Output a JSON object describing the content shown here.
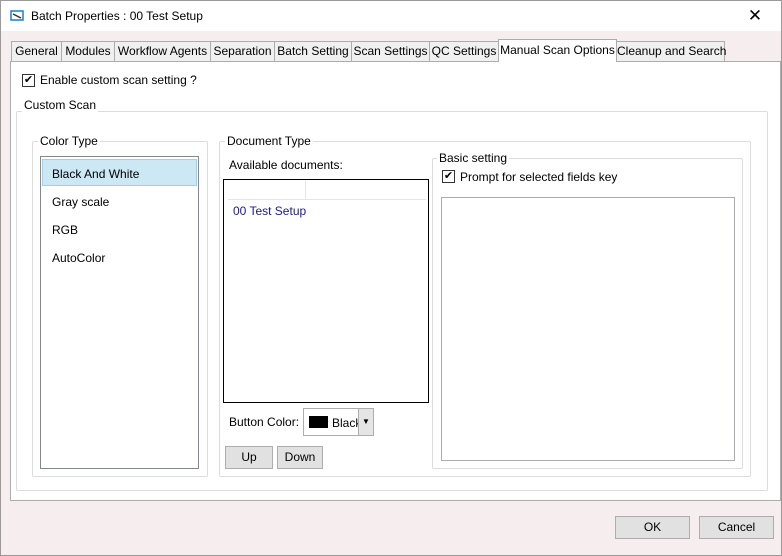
{
  "window": {
    "title": "Batch Properties : 00 Test Setup",
    "close": "✕"
  },
  "tabs": [
    {
      "label": "General"
    },
    {
      "label": "Modules"
    },
    {
      "label": "Workflow Agents"
    },
    {
      "label": "Separation"
    },
    {
      "label": "Batch Setting"
    },
    {
      "label": "Scan Settings"
    },
    {
      "label": "QC Settings"
    },
    {
      "label": "Manual Scan Options",
      "selected": true
    },
    {
      "label": "Cleanup and Search"
    }
  ],
  "enable_custom": {
    "label": "Enable custom scan setting ?",
    "checked": true
  },
  "custom_scan": {
    "label": "Custom Scan"
  },
  "color_type": {
    "label": "Color Type",
    "items": [
      "Black And White",
      "Gray scale",
      "RGB",
      "AutoColor"
    ],
    "selected": "Black And White"
  },
  "document_type": {
    "label": "Document Type",
    "available_label": "Available documents:",
    "documents": [
      "00 Test Setup"
    ],
    "button_color_label": "Button Color:",
    "button_color": {
      "value": "Black",
      "swatch": "#000000"
    },
    "up": "Up",
    "down": "Down"
  },
  "basic_setting": {
    "label": "Basic setting",
    "prompt": {
      "label": "Prompt for selected fields key",
      "checked": true
    }
  },
  "footer": {
    "ok": "OK",
    "cancel": "Cancel"
  },
  "colors": {
    "selection_bg": "#cce8ff",
    "selection_border": "#99d1ff",
    "doc_text": "#1a1a8c"
  }
}
